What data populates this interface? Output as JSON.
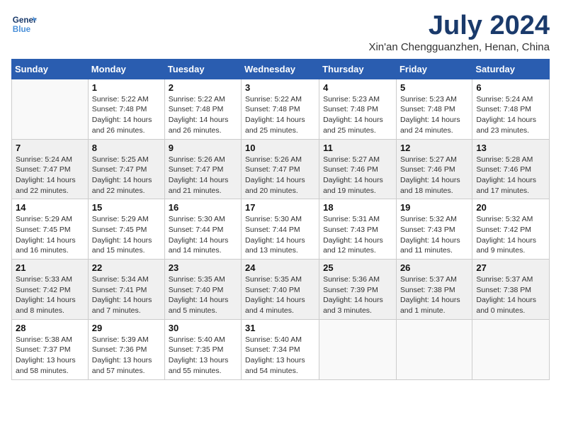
{
  "header": {
    "logo_line1": "General",
    "logo_line2": "Blue",
    "month_year": "July 2024",
    "location": "Xin'an Chengguanzhen, Henan, China"
  },
  "days_of_week": [
    "Sunday",
    "Monday",
    "Tuesday",
    "Wednesday",
    "Thursday",
    "Friday",
    "Saturday"
  ],
  "weeks": [
    [
      {
        "day": "",
        "info": ""
      },
      {
        "day": "1",
        "info": "Sunrise: 5:22 AM\nSunset: 7:48 PM\nDaylight: 14 hours\nand 26 minutes."
      },
      {
        "day": "2",
        "info": "Sunrise: 5:22 AM\nSunset: 7:48 PM\nDaylight: 14 hours\nand 26 minutes."
      },
      {
        "day": "3",
        "info": "Sunrise: 5:22 AM\nSunset: 7:48 PM\nDaylight: 14 hours\nand 25 minutes."
      },
      {
        "day": "4",
        "info": "Sunrise: 5:23 AM\nSunset: 7:48 PM\nDaylight: 14 hours\nand 25 minutes."
      },
      {
        "day": "5",
        "info": "Sunrise: 5:23 AM\nSunset: 7:48 PM\nDaylight: 14 hours\nand 24 minutes."
      },
      {
        "day": "6",
        "info": "Sunrise: 5:24 AM\nSunset: 7:48 PM\nDaylight: 14 hours\nand 23 minutes."
      }
    ],
    [
      {
        "day": "7",
        "info": "Sunrise: 5:24 AM\nSunset: 7:47 PM\nDaylight: 14 hours\nand 22 minutes."
      },
      {
        "day": "8",
        "info": "Sunrise: 5:25 AM\nSunset: 7:47 PM\nDaylight: 14 hours\nand 22 minutes."
      },
      {
        "day": "9",
        "info": "Sunrise: 5:26 AM\nSunset: 7:47 PM\nDaylight: 14 hours\nand 21 minutes."
      },
      {
        "day": "10",
        "info": "Sunrise: 5:26 AM\nSunset: 7:47 PM\nDaylight: 14 hours\nand 20 minutes."
      },
      {
        "day": "11",
        "info": "Sunrise: 5:27 AM\nSunset: 7:46 PM\nDaylight: 14 hours\nand 19 minutes."
      },
      {
        "day": "12",
        "info": "Sunrise: 5:27 AM\nSunset: 7:46 PM\nDaylight: 14 hours\nand 18 minutes."
      },
      {
        "day": "13",
        "info": "Sunrise: 5:28 AM\nSunset: 7:46 PM\nDaylight: 14 hours\nand 17 minutes."
      }
    ],
    [
      {
        "day": "14",
        "info": "Sunrise: 5:29 AM\nSunset: 7:45 PM\nDaylight: 14 hours\nand 16 minutes."
      },
      {
        "day": "15",
        "info": "Sunrise: 5:29 AM\nSunset: 7:45 PM\nDaylight: 14 hours\nand 15 minutes."
      },
      {
        "day": "16",
        "info": "Sunrise: 5:30 AM\nSunset: 7:44 PM\nDaylight: 14 hours\nand 14 minutes."
      },
      {
        "day": "17",
        "info": "Sunrise: 5:30 AM\nSunset: 7:44 PM\nDaylight: 14 hours\nand 13 minutes."
      },
      {
        "day": "18",
        "info": "Sunrise: 5:31 AM\nSunset: 7:43 PM\nDaylight: 14 hours\nand 12 minutes."
      },
      {
        "day": "19",
        "info": "Sunrise: 5:32 AM\nSunset: 7:43 PM\nDaylight: 14 hours\nand 11 minutes."
      },
      {
        "day": "20",
        "info": "Sunrise: 5:32 AM\nSunset: 7:42 PM\nDaylight: 14 hours\nand 9 minutes."
      }
    ],
    [
      {
        "day": "21",
        "info": "Sunrise: 5:33 AM\nSunset: 7:42 PM\nDaylight: 14 hours\nand 8 minutes."
      },
      {
        "day": "22",
        "info": "Sunrise: 5:34 AM\nSunset: 7:41 PM\nDaylight: 14 hours\nand 7 minutes."
      },
      {
        "day": "23",
        "info": "Sunrise: 5:35 AM\nSunset: 7:40 PM\nDaylight: 14 hours\nand 5 minutes."
      },
      {
        "day": "24",
        "info": "Sunrise: 5:35 AM\nSunset: 7:40 PM\nDaylight: 14 hours\nand 4 minutes."
      },
      {
        "day": "25",
        "info": "Sunrise: 5:36 AM\nSunset: 7:39 PM\nDaylight: 14 hours\nand 3 minutes."
      },
      {
        "day": "26",
        "info": "Sunrise: 5:37 AM\nSunset: 7:38 PM\nDaylight: 14 hours\nand 1 minute."
      },
      {
        "day": "27",
        "info": "Sunrise: 5:37 AM\nSunset: 7:38 PM\nDaylight: 14 hours\nand 0 minutes."
      }
    ],
    [
      {
        "day": "28",
        "info": "Sunrise: 5:38 AM\nSunset: 7:37 PM\nDaylight: 13 hours\nand 58 minutes."
      },
      {
        "day": "29",
        "info": "Sunrise: 5:39 AM\nSunset: 7:36 PM\nDaylight: 13 hours\nand 57 minutes."
      },
      {
        "day": "30",
        "info": "Sunrise: 5:40 AM\nSunset: 7:35 PM\nDaylight: 13 hours\nand 55 minutes."
      },
      {
        "day": "31",
        "info": "Sunrise: 5:40 AM\nSunset: 7:34 PM\nDaylight: 13 hours\nand 54 minutes."
      },
      {
        "day": "",
        "info": ""
      },
      {
        "day": "",
        "info": ""
      },
      {
        "day": "",
        "info": ""
      }
    ]
  ]
}
